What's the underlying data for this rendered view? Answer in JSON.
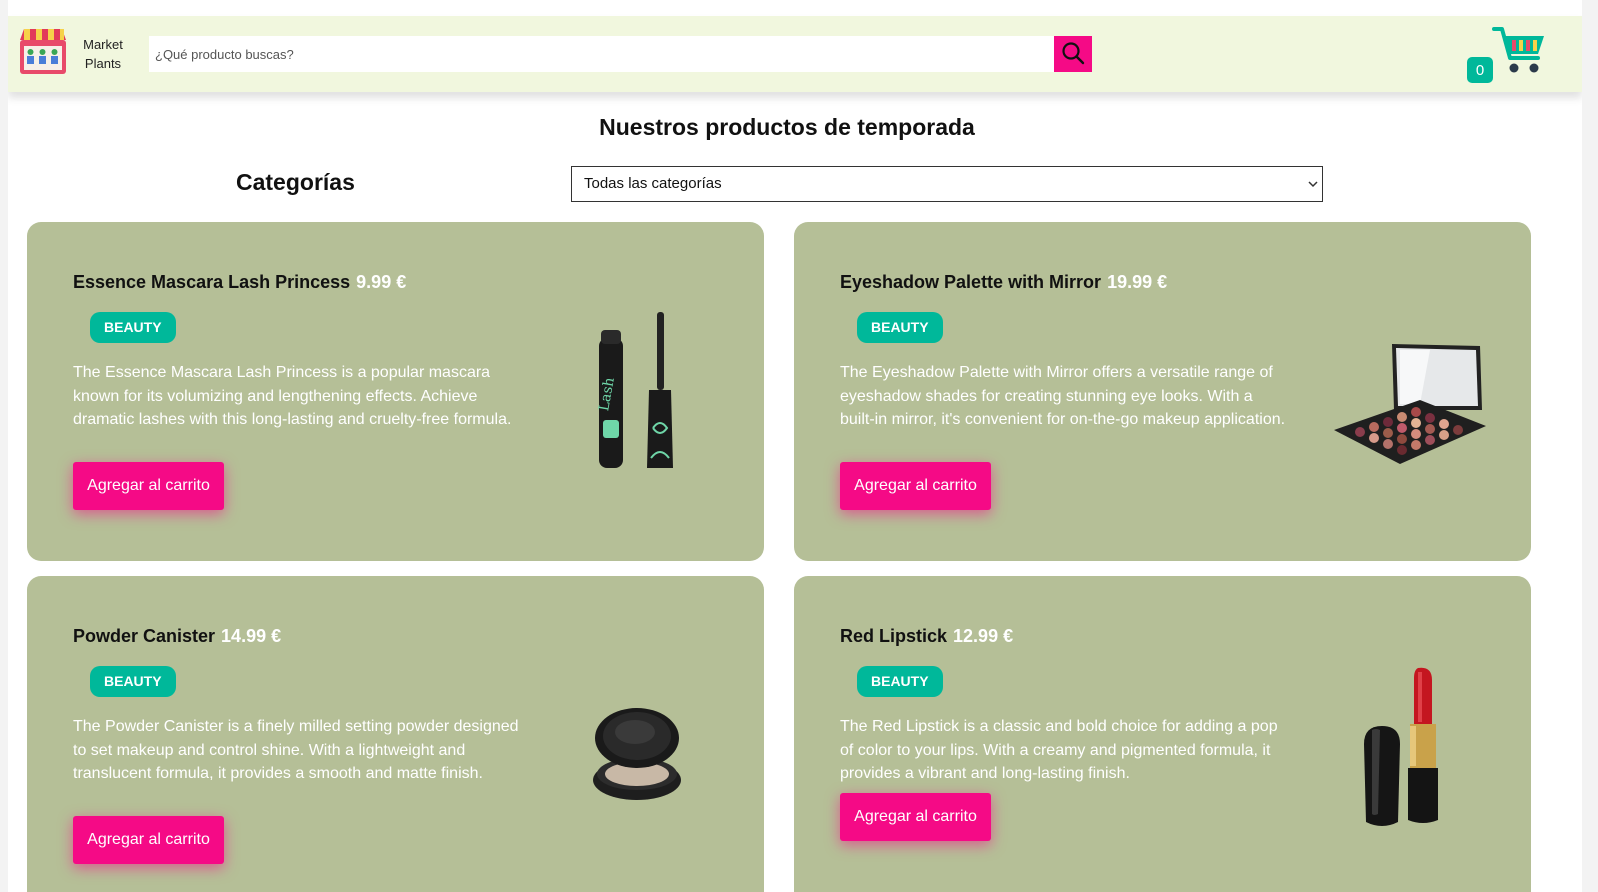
{
  "header": {
    "brand_line1": "Market",
    "brand_line2": "Plants",
    "search_placeholder": "¿Qué producto buscas?",
    "cart_count": "0"
  },
  "main": {
    "title": "Nuestros productos de temporada",
    "categories_label": "Categorías",
    "category_selected": "Todas las categorías"
  },
  "products": [
    {
      "name": "Essence Mascara Lash Princess",
      "price": "9.99 €",
      "category": "BEAUTY",
      "description": "The Essence Mascara Lash Princess is a popular mascara known for its volumizing and lengthening effects. Achieve dramatic lashes with this long-lasting and cruelty-free formula.",
      "button": "Agregar al carrito",
      "image_icon": "mascara-icon"
    },
    {
      "name": "Eyeshadow Palette with Mirror",
      "price": "19.99 €",
      "category": "BEAUTY",
      "description": "The Eyeshadow Palette with Mirror offers a versatile range of eyeshadow shades for creating stunning eye looks. With a built-in mirror, it's convenient for on-the-go makeup application.",
      "button": "Agregar al carrito",
      "image_icon": "eyeshadow-palette-icon"
    },
    {
      "name": "Powder Canister",
      "price": "14.99 €",
      "category": "BEAUTY",
      "description": "The Powder Canister is a finely milled setting powder designed to set makeup and control shine. With a lightweight and translucent formula, it provides a smooth and matte finish.",
      "button": "Agregar al carrito",
      "image_icon": "powder-canister-icon"
    },
    {
      "name": "Red Lipstick",
      "price": "12.99 €",
      "category": "BEAUTY",
      "description": "The Red Lipstick is a classic and bold choice for adding a pop of color to your lips. With a creamy and pigmented formula, it provides a vibrant and long-lasting finish.",
      "button": "Agregar al carrito",
      "image_icon": "lipstick-icon"
    }
  ],
  "colors": {
    "header_bg": "#f1f7de",
    "accent_pink": "#f50a86",
    "badge_teal": "#00b89a",
    "card_bg": "#b5bf97"
  }
}
